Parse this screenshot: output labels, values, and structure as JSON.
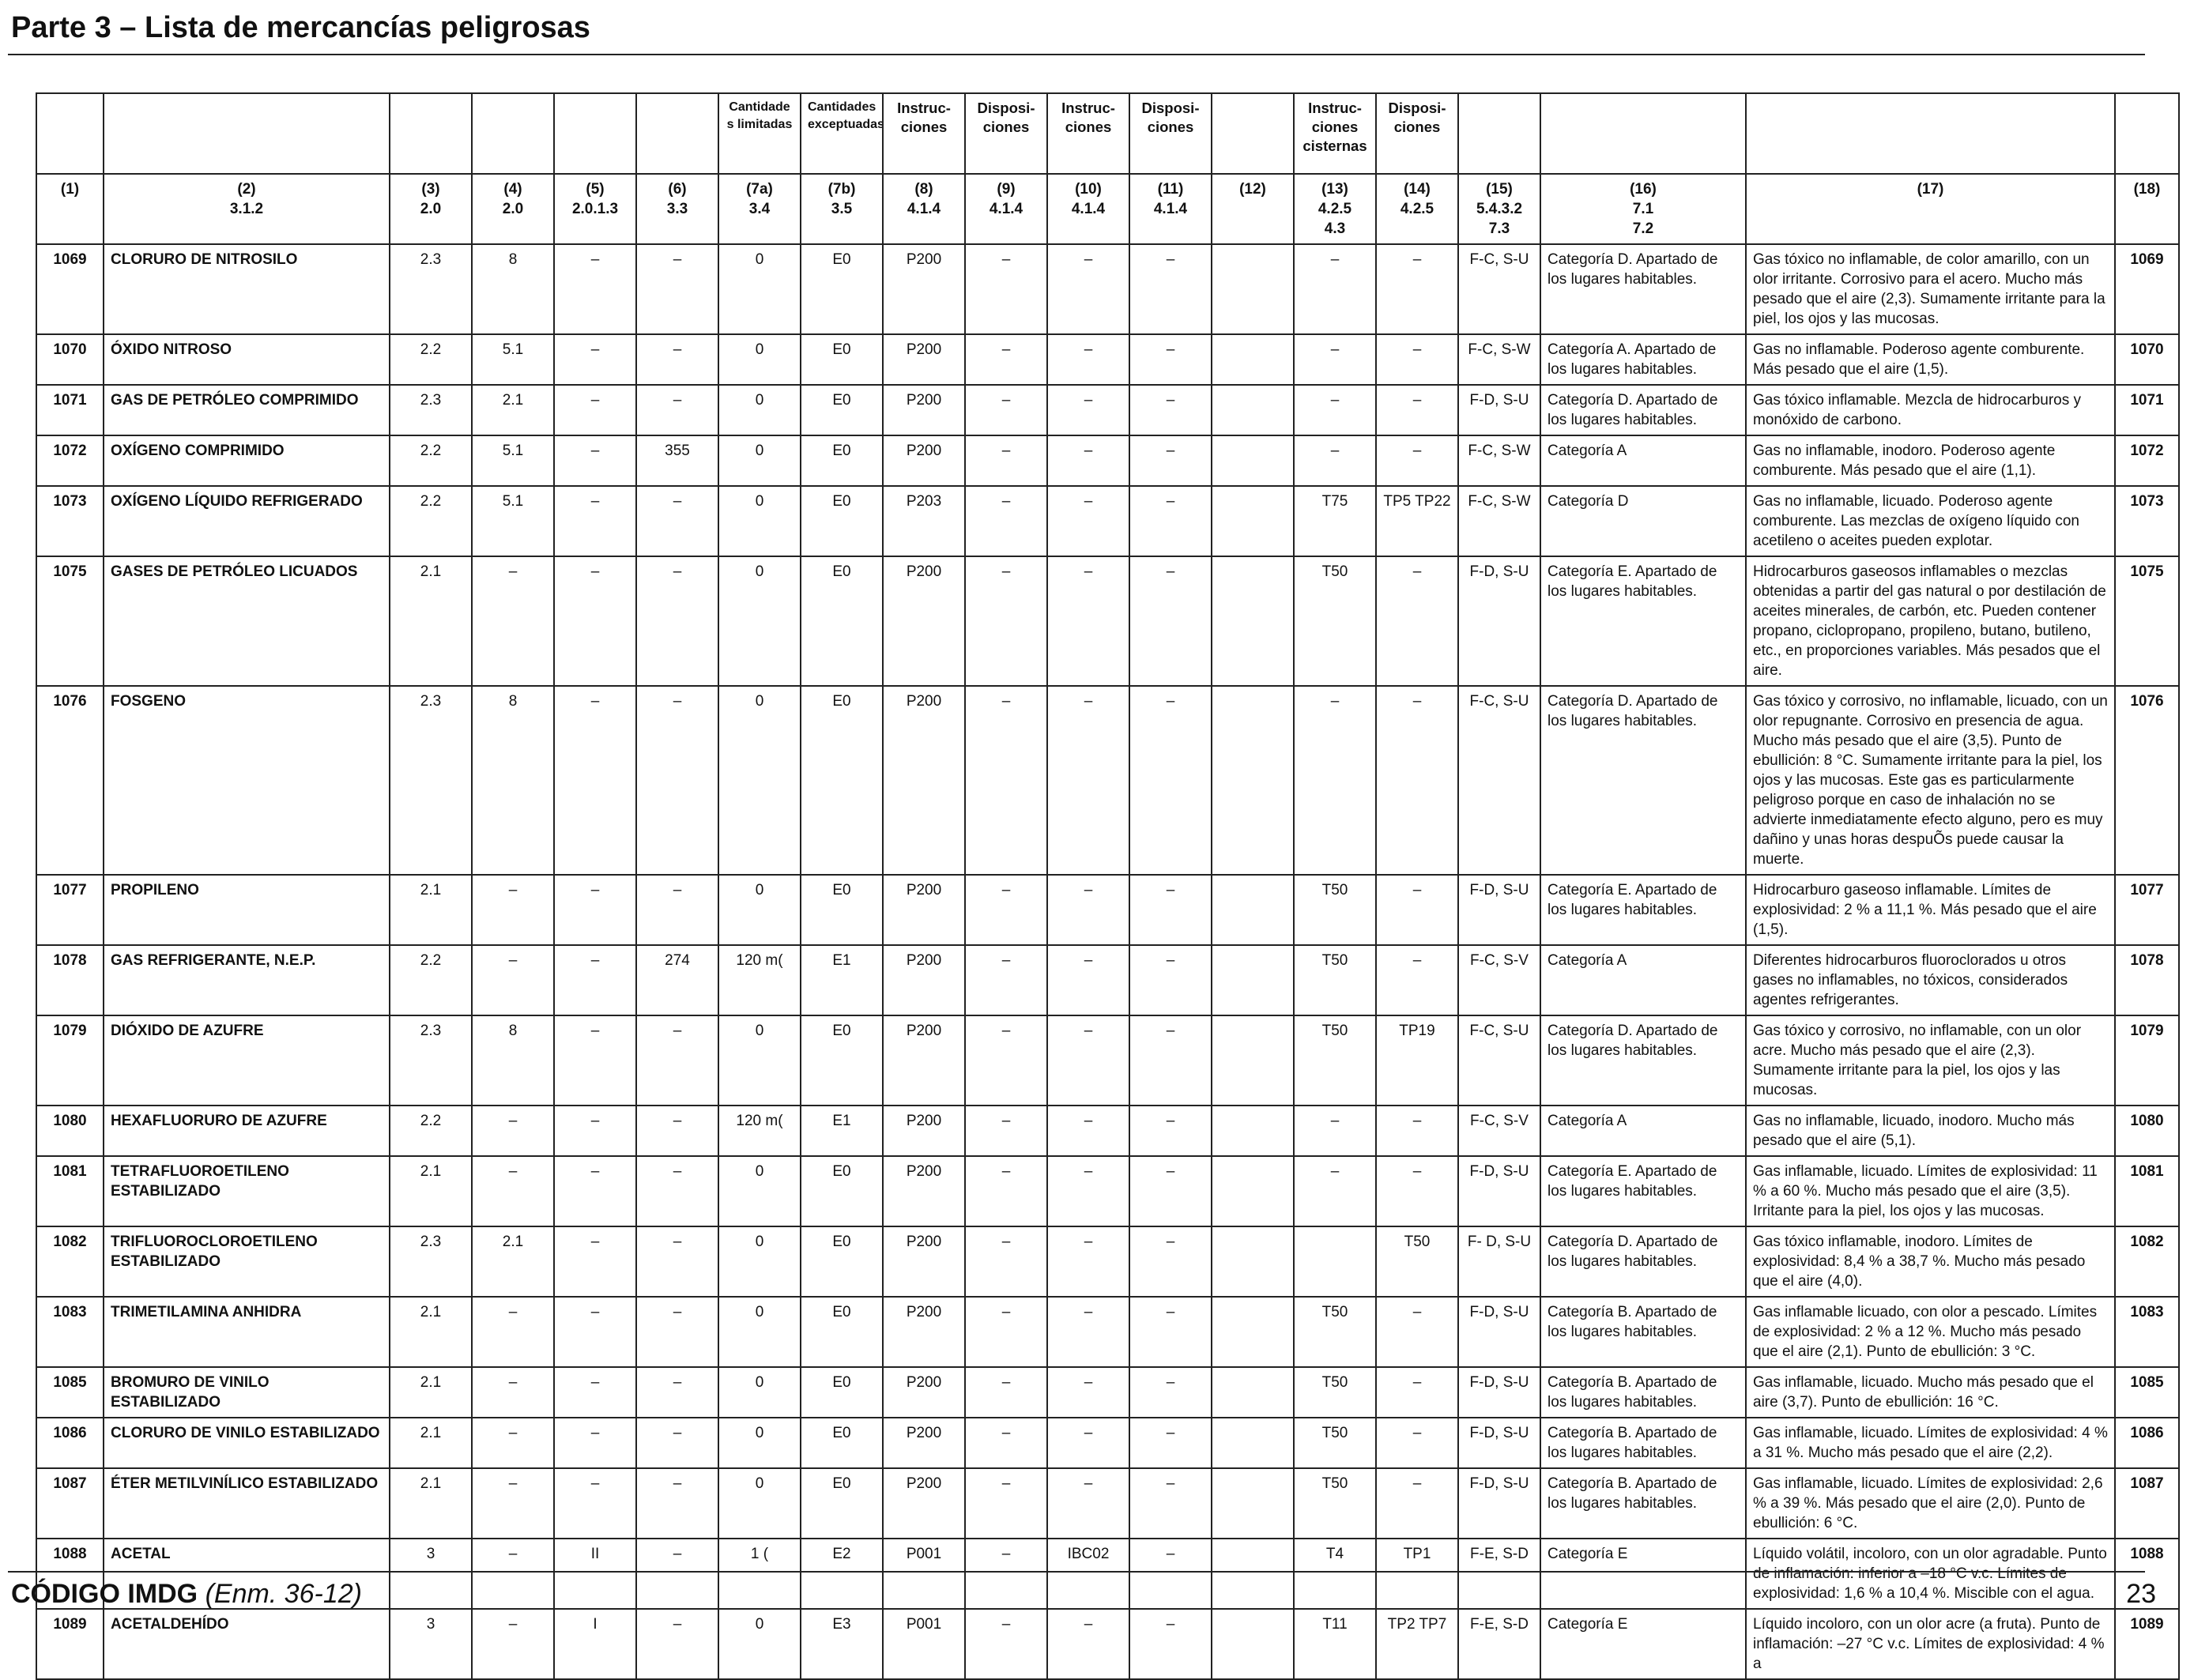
{
  "header": {
    "title": "Parte 3 – Lista de mercancías peligrosas"
  },
  "footer": {
    "code": "CÓDIGO IMDG",
    "edition": "(Enm. 36-12)",
    "page_number": "23"
  },
  "table": {
    "header_top": [
      "",
      "",
      "",
      "",
      "",
      "",
      "Cantidade s limitadas",
      "Cantidades exceptuadas",
      "Instruc- ciones",
      "Disposi- ciones",
      "Instruc- ciones",
      "Disposi- ciones",
      "",
      "Instruc- ciones cisternas",
      "Disposi- ciones",
      "",
      "",
      "",
      ""
    ],
    "header_cols": [
      [
        "(1)"
      ],
      [
        "(2)",
        "3.1.2"
      ],
      [
        "(3)",
        "2.0"
      ],
      [
        "(4)",
        "2.0"
      ],
      [
        "(5)",
        "2.0.1.3"
      ],
      [
        "(6)",
        "3.3"
      ],
      [
        "(7a)",
        "3.4"
      ],
      [
        "(7b)",
        "3.5"
      ],
      [
        "(8)",
        "4.1.4"
      ],
      [
        "(9)",
        "4.1.4"
      ],
      [
        "(10)",
        "4.1.4"
      ],
      [
        "(11)",
        "4.1.4"
      ],
      [
        "(12)"
      ],
      [
        "(13)",
        "4.2.5",
        "4.3"
      ],
      [
        "(14)",
        "4.2.5"
      ],
      [
        "(15)",
        "5.4.3.2",
        "7.3"
      ],
      [
        "(16)",
        "7.1",
        "7.2"
      ],
      [
        "(17)"
      ],
      [
        "(18)"
      ]
    ],
    "rows": [
      {
        "un": "1069",
        "name": "CLORURO DE NITROSILO",
        "c3": "2.3",
        "c4": "8",
        "c5": "–",
        "c6": "–",
        "c7a": "0",
        "c7b": "E0",
        "c8": "P200",
        "c9": "–",
        "c10": "–",
        "c11": "–",
        "c12": "",
        "c13": "–",
        "c14": "–",
        "c15": "F-C, S-U",
        "c16": "Categoría D. Apartado de los lugares habitables.",
        "c17": "Gas tóxico no inflamable, de color amarillo, con un olor irritante. Corrosivo para el acero. Mucho más pesado que el aire (2,3). Sumamente irritante para la piel, los ojos y las mucosas.",
        "un2": "1069"
      },
      {
        "un": "1070",
        "name": "ÓXIDO NITROSO",
        "c3": "2.2",
        "c4": "5.1",
        "c5": "–",
        "c6": "–",
        "c7a": "0",
        "c7b": "E0",
        "c8": "P200",
        "c9": "–",
        "c10": "–",
        "c11": "–",
        "c12": "",
        "c13": "–",
        "c14": "–",
        "c15": "F-C, S-W",
        "c16": "Categoría A. Apartado de los lugares habitables.",
        "c17": "Gas no inflamable. Poderoso agente comburente. Más pesado que el aire (1,5).",
        "un2": "1070"
      },
      {
        "un": "1071",
        "name": "GAS DE PETRÓLEO COMPRIMIDO",
        "c3": "2.3",
        "c4": "2.1",
        "c5": "–",
        "c6": "–",
        "c7a": "0",
        "c7b": "E0",
        "c8": "P200",
        "c9": "–",
        "c10": "–",
        "c11": "–",
        "c12": "",
        "c13": "–",
        "c14": "–",
        "c15": "F-D, S-U",
        "c16": "Categoría D. Apartado de los lugares habitables.",
        "c17": "Gas tóxico inflamable. Mezcla de hidrocarburos y monóxido de carbono.",
        "un2": "1071"
      },
      {
        "un": "1072",
        "name": "OXÍGENO COMPRIMIDO",
        "c3": "2.2",
        "c4": "5.1",
        "c5": "–",
        "c6": "355",
        "c7a": "0",
        "c7b": "E0",
        "c8": "P200",
        "c9": "–",
        "c10": "–",
        "c11": "–",
        "c12": "",
        "c13": "–",
        "c14": "–",
        "c15": "F-C, S-W",
        "c16": "Categoría A",
        "c17": "Gas no inflamable, inodoro. Poderoso agente comburente. Más pesado que el aire (1,1).",
        "un2": "1072"
      },
      {
        "un": "1073",
        "name": "OXÍGENO LÍQUIDO REFRIGERADO",
        "c3": "2.2",
        "c4": "5.1",
        "c5": "–",
        "c6": "–",
        "c7a": "0",
        "c7b": "E0",
        "c8": "P203",
        "c9": "–",
        "c10": "–",
        "c11": "–",
        "c12": "",
        "c13": "T75",
        "c14": "TP5 TP22",
        "c15": "F-C, S-W",
        "c16": "Categoría D",
        "c17": "Gas no inflamable, licuado. Poderoso agente comburente. Las mezclas de oxígeno líquido con acetileno o aceites pueden explotar.",
        "un2": "1073"
      },
      {
        "un": "1075",
        "name": "GASES DE PETRÓLEO LICUADOS",
        "c3": "2.1",
        "c4": "–",
        "c5": "–",
        "c6": "–",
        "c7a": "0",
        "c7b": "E0",
        "c8": "P200",
        "c9": "–",
        "c10": "–",
        "c11": "–",
        "c12": "",
        "c13": "T50",
        "c14": "–",
        "c15": "F-D, S-U",
        "c16": "Categoría E. Apartado de los lugares habitables.",
        "c17": "Hidrocarburos gaseosos inflamables o mezclas obtenidas a partir del gas natural o por destilación de aceites minerales, de carbón, etc. Pueden contener propano, ciclopropano, propileno, butano, butileno, etc., en proporciones variables. Más pesados que el aire.",
        "un2": "1075"
      },
      {
        "un": "1076",
        "name": "FOSGENO",
        "c3": "2.3",
        "c4": "8",
        "c5": "–",
        "c6": "–",
        "c7a": "0",
        "c7b": "E0",
        "c8": "P200",
        "c9": "–",
        "c10": "–",
        "c11": "–",
        "c12": "",
        "c13": "–",
        "c14": "–",
        "c15": "F-C, S-U",
        "c16": "Categoría D. Apartado de los lugares habitables.",
        "c17": "Gas tóxico y corrosivo, no inflamable, licuado, con un olor repugnante. Corrosivo en presencia de agua. Mucho más pesado que el aire (3,5). Punto de ebullición: 8 °C. Sumamente irritante para la piel, los ojos y las mucosas. Este gas es particularmente peligroso porque en caso de inhalación no se advierte inmediatamente efecto alguno, pero es muy dañino y unas horas despuÕs puede causar la muerte.",
        "un2": "1076"
      },
      {
        "un": "1077",
        "name": "PROPILENO",
        "c3": "2.1",
        "c4": "–",
        "c5": "–",
        "c6": "–",
        "c7a": "0",
        "c7b": "E0",
        "c8": "P200",
        "c9": "–",
        "c10": "–",
        "c11": "–",
        "c12": "",
        "c13": "T50",
        "c14": "–",
        "c15": "F-D, S-U",
        "c16": "Categoría E. Apartado de los lugares habitables.",
        "c17": "Hidrocarburo gaseoso inflamable. Límites de explosividad: 2 % a 11,1 %. Más pesado que el aire (1,5).",
        "un2": "1077"
      },
      {
        "un": "1078",
        "name": "GAS REFRIGERANTE, N.E.P.",
        "c3": "2.2",
        "c4": "–",
        "c5": "–",
        "c6": "274",
        "c7a": "120 m(",
        "c7b": "E1",
        "c8": "P200",
        "c9": "–",
        "c10": "–",
        "c11": "–",
        "c12": "",
        "c13": "T50",
        "c14": "–",
        "c15": "F-C, S-V",
        "c16": "Categoría A",
        "c17": "Diferentes hidrocarburos fluoroclorados u otros gases no inflamables, no tóxicos, considerados agentes refrigerantes.",
        "un2": "1078"
      },
      {
        "un": "1079",
        "name": "DIÓXIDO DE AZUFRE",
        "c3": "2.3",
        "c4": "8",
        "c5": "–",
        "c6": "–",
        "c7a": "0",
        "c7b": "E0",
        "c8": "P200",
        "c9": "–",
        "c10": "–",
        "c11": "–",
        "c12": "",
        "c13": "T50",
        "c14": "TP19",
        "c15": "F-C, S-U",
        "c16": "Categoría D. Apartado de los lugares habitables.",
        "c17": "Gas tóxico y corrosivo, no inflamable, con un olor acre. Mucho más pesado que el aire (2,3). Sumamente irritante para la piel, los ojos y las mucosas.",
        "un2": "1079"
      },
      {
        "un": "1080",
        "name": "HEXAFLUORURO DE AZUFRE",
        "c3": "2.2",
        "c4": "–",
        "c5": "–",
        "c6": "–",
        "c7a": "120 m(",
        "c7b": "E1",
        "c8": "P200",
        "c9": "–",
        "c10": "–",
        "c11": "–",
        "c12": "",
        "c13": "–",
        "c14": "–",
        "c15": "F-C, S-V",
        "c16": "Categoría A",
        "c17": "Gas no inflamable, licuado, inodoro. Mucho más pesado que el aire (5,1).",
        "un2": "1080"
      },
      {
        "un": "1081",
        "name": "TETRAFLUOROETILENO ESTABILIZADO",
        "c3": "2.1",
        "c4": "–",
        "c5": "–",
        "c6": "–",
        "c7a": "0",
        "c7b": "E0",
        "c8": "P200",
        "c9": "–",
        "c10": "–",
        "c11": "–",
        "c12": "",
        "c13": "–",
        "c14": "–",
        "c15": "F-D, S-U",
        "c16": "Categoría E. Apartado de los lugares habitables.",
        "c17": "Gas inflamable, licuado. Límites de explosividad: 11 % a 60 %. Mucho más pesado que el aire (3,5). Irritante para la piel, los ojos y las mucosas.",
        "un2": "1081"
      },
      {
        "un": "1082",
        "name": "TRIFLUOROCLOROETILENO ESTABILIZADO",
        "c3": "2.3",
        "c4": "2.1",
        "c5": "–",
        "c6": "–",
        "c7a": "0",
        "c7b": "E0",
        "c8": "P200",
        "c9": "–",
        "c10": "–",
        "c11": "–",
        "c12": "",
        "c13": "",
        "c14": "T50",
        "c15": "F- D, S-U",
        "c16": "Categoría D. Apartado de los lugares habitables.",
        "c17": "Gas tóxico inflamable, inodoro. Límites de explosividad: 8,4 % a 38,7 %. Mucho más pesado que el aire (4,0).",
        "un2": "1082"
      },
      {
        "un": "1083",
        "name": "TRIMETILAMINA ANHIDRA",
        "c3": "2.1",
        "c4": "–",
        "c5": "–",
        "c6": "–",
        "c7a": "0",
        "c7b": "E0",
        "c8": "P200",
        "c9": "–",
        "c10": "–",
        "c11": "–",
        "c12": "",
        "c13": "T50",
        "c14": "–",
        "c15": "F-D, S-U",
        "c16": "Categoría B. Apartado de los lugares habitables.",
        "c17": "Gas inflamable licuado, con olor a pescado. Límites de explosividad: 2 % a 12 %. Mucho más pesado que el aire (2,1). Punto de ebullición: 3 °C.",
        "un2": "1083"
      },
      {
        "un": "1085",
        "name": "BROMURO DE VINILO ESTABILIZADO",
        "c3": "2.1",
        "c4": "–",
        "c5": "–",
        "c6": "–",
        "c7a": "0",
        "c7b": "E0",
        "c8": "P200",
        "c9": "–",
        "c10": "–",
        "c11": "–",
        "c12": "",
        "c13": "T50",
        "c14": "–",
        "c15": "F-D, S-U",
        "c16": "Categoría B. Apartado de los lugares habitables.",
        "c17": "Gas inflamable, licuado. Mucho más pesado que el aire (3,7). Punto de ebullición: 16 °C.",
        "un2": "1085"
      },
      {
        "un": "1086",
        "name": "CLORURO DE VINILO ESTABILIZADO",
        "c3": "2.1",
        "c4": "–",
        "c5": "–",
        "c6": "–",
        "c7a": "0",
        "c7b": "E0",
        "c8": "P200",
        "c9": "–",
        "c10": "–",
        "c11": "–",
        "c12": "",
        "c13": "T50",
        "c14": "–",
        "c15": "F-D, S-U",
        "c16": "Categoría B. Apartado de los lugares habitables.",
        "c17": "Gas inflamable, licuado. Límites de explosividad: 4 % a 31 %. Mucho más pesado que el aire (2,2).",
        "un2": "1086"
      },
      {
        "un": "1087",
        "name": "ÉTER METILVINÍLICO ESTABILIZADO",
        "c3": "2.1",
        "c4": "–",
        "c5": "–",
        "c6": "–",
        "c7a": "0",
        "c7b": "E0",
        "c8": "P200",
        "c9": "–",
        "c10": "–",
        "c11": "–",
        "c12": "",
        "c13": "T50",
        "c14": "–",
        "c15": "F-D, S-U",
        "c16": "Categoría B. Apartado de los lugares habitables.",
        "c17": "Gas inflamable, licuado. Límites de explosividad: 2,6 % a 39 %. Más pesado que el aire (2,0). Punto de ebullición: 6 °C.",
        "un2": "1087"
      },
      {
        "un": "1088",
        "name": "ACETAL",
        "c3": "3",
        "c4": "–",
        "c5": "II",
        "c6": "–",
        "c7a": "1 (",
        "c7b": "E2",
        "c8": "P001",
        "c9": "–",
        "c10": "IBC02",
        "c11": "–",
        "c12": "",
        "c13": "T4",
        "c14": "TP1",
        "c15": "F-E, S-D",
        "c16": "Categoría E",
        "c17": "Líquido volátil, incoloro, con un olor agradable. Punto de inflamación: inferior a –18 °C v.c. Límites de explosividad: 1,6 % a 10,4 %. Miscible con el agua.",
        "un2": "1088"
      },
      {
        "un": "1089",
        "name": "ACETALDEHÍDO",
        "c3": "3",
        "c4": "–",
        "c5": "I",
        "c6": "–",
        "c7a": "0",
        "c7b": "E3",
        "c8": "P001",
        "c9": "–",
        "c10": "–",
        "c11": "–",
        "c12": "",
        "c13": "T11",
        "c14": "TP2 TP7",
        "c15": "F-E, S-D",
        "c16": "Categoría E",
        "c17": "Líquido incoloro, con un olor acre (a fruta). Punto de inflamación: –27 °C v.c. Límites de explosividad: 4 % a",
        "un2": "1089"
      }
    ]
  }
}
